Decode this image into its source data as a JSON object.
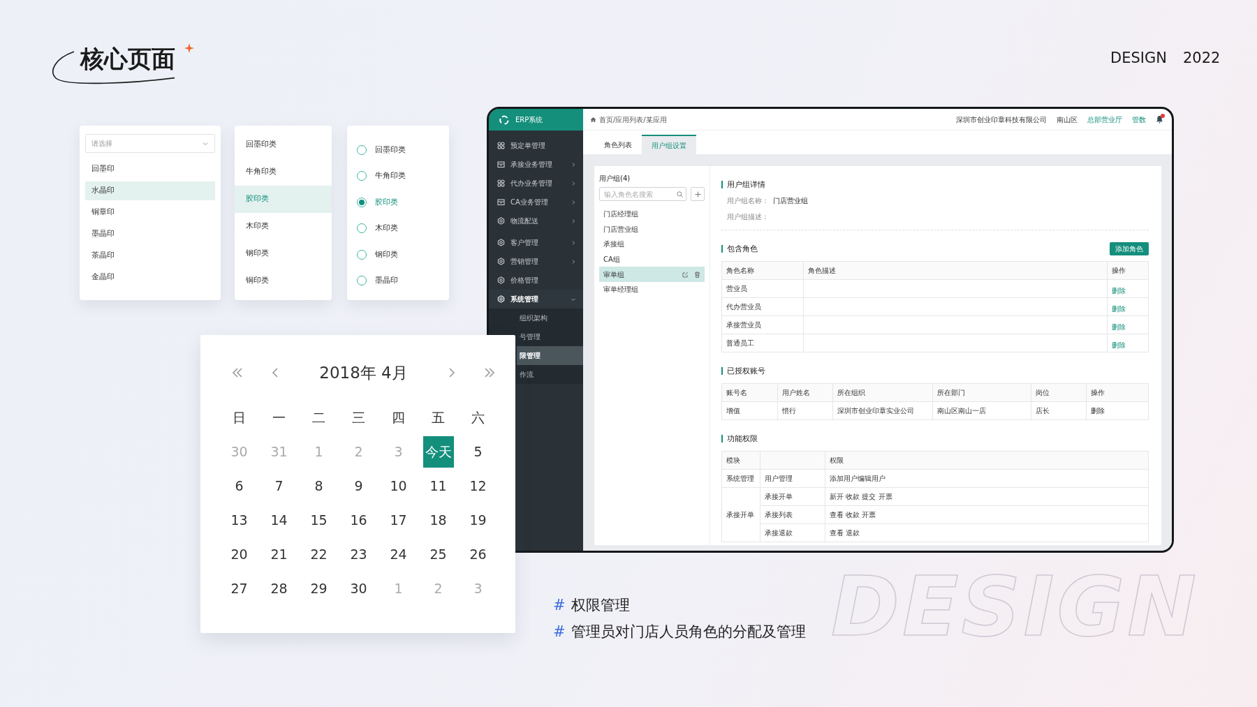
{
  "page": {
    "title": "核心页面",
    "brand": "DESIGN",
    "year": "2022",
    "background_word": "DESIGN"
  },
  "select_panel": {
    "placeholder": "请选择",
    "options": [
      {
        "label": "回墨印",
        "selected": false
      },
      {
        "label": "水晶印",
        "selected": true
      },
      {
        "label": "铜章印",
        "selected": false
      },
      {
        "label": "墨晶印",
        "selected": false
      },
      {
        "label": "茶晶印",
        "selected": false
      },
      {
        "label": "金晶印",
        "selected": false
      }
    ]
  },
  "list_panel": {
    "options": [
      {
        "label": "回墨印类",
        "selected": false
      },
      {
        "label": "牛角印类",
        "selected": false
      },
      {
        "label": "胶印类",
        "selected": true
      },
      {
        "label": "木印类",
        "selected": false
      },
      {
        "label": "钢印类",
        "selected": false
      },
      {
        "label": "铜印类",
        "selected": false
      }
    ]
  },
  "radio_panel": {
    "options": [
      {
        "label": "回墨印类",
        "selected": false
      },
      {
        "label": "牛角印类",
        "selected": false
      },
      {
        "label": "胶印类",
        "selected": true
      },
      {
        "label": "木印类",
        "selected": false
      },
      {
        "label": "钢印类",
        "selected": false
      },
      {
        "label": "墨晶印",
        "selected": false
      }
    ]
  },
  "calendar": {
    "month_label": "2018年 4月",
    "weekdays": [
      "日",
      "一",
      "二",
      "三",
      "四",
      "五",
      "六"
    ],
    "weeks": [
      [
        {
          "label": "30",
          "muted": true,
          "selected": false
        },
        {
          "label": "31",
          "muted": true,
          "selected": false
        },
        {
          "label": "1",
          "muted": true,
          "selected": false
        },
        {
          "label": "2",
          "muted": true,
          "selected": false
        },
        {
          "label": "3",
          "muted": true,
          "selected": false
        },
        {
          "label": "今天",
          "muted": false,
          "selected": true
        },
        {
          "label": "5",
          "muted": false,
          "selected": false
        }
      ],
      [
        {
          "label": "6",
          "muted": false,
          "selected": false
        },
        {
          "label": "7",
          "muted": false,
          "selected": false
        },
        {
          "label": "8",
          "muted": false,
          "selected": false
        },
        {
          "label": "9",
          "muted": false,
          "selected": false
        },
        {
          "label": "10",
          "muted": false,
          "selected": false
        },
        {
          "label": "11",
          "muted": false,
          "selected": false
        },
        {
          "label": "12",
          "muted": false,
          "selected": false
        }
      ],
      [
        {
          "label": "13",
          "muted": false,
          "selected": false
        },
        {
          "label": "14",
          "muted": false,
          "selected": false
        },
        {
          "label": "15",
          "muted": false,
          "selected": false
        },
        {
          "label": "16",
          "muted": false,
          "selected": false
        },
        {
          "label": "17",
          "muted": false,
          "selected": false
        },
        {
          "label": "18",
          "muted": false,
          "selected": false
        },
        {
          "label": "19",
          "muted": false,
          "selected": false
        }
      ],
      [
        {
          "label": "20",
          "muted": false,
          "selected": false
        },
        {
          "label": "21",
          "muted": false,
          "selected": false
        },
        {
          "label": "22",
          "muted": false,
          "selected": false
        },
        {
          "label": "23",
          "muted": false,
          "selected": false
        },
        {
          "label": "24",
          "muted": false,
          "selected": false
        },
        {
          "label": "25",
          "muted": false,
          "selected": false
        },
        {
          "label": "26",
          "muted": false,
          "selected": false
        }
      ],
      [
        {
          "label": "27",
          "muted": false,
          "selected": false
        },
        {
          "label": "28",
          "muted": false,
          "selected": false
        },
        {
          "label": "29",
          "muted": false,
          "selected": false
        },
        {
          "label": "30",
          "muted": false,
          "selected": false
        },
        {
          "label": "1",
          "muted": true,
          "selected": false
        },
        {
          "label": "2",
          "muted": true,
          "selected": false
        },
        {
          "label": "3",
          "muted": true,
          "selected": false
        }
      ]
    ]
  },
  "erp": {
    "app_name": "ERP系统",
    "breadcrumb": "首页/应用列表/某应用",
    "header_items": [
      {
        "label": "深圳市创业印章科技有限公司",
        "kind": "text"
      },
      {
        "label": "南山区",
        "kind": "text"
      },
      {
        "label": "总部营业厅",
        "kind": "link"
      },
      {
        "label": "管数",
        "kind": "link"
      }
    ],
    "sidebar": [
      {
        "label": "预定单管理",
        "kind": "grid"
      },
      {
        "label": "承接业务管理",
        "kind": "box",
        "expanded": false
      },
      {
        "label": "代办业务管理",
        "kind": "grid",
        "expanded": false
      },
      {
        "label": "CA业务管理",
        "kind": "box",
        "expanded": false
      },
      {
        "label": "物流配送",
        "kind": "gear",
        "expanded": false
      },
      {
        "label": "客户管理",
        "kind": "gear",
        "expanded": false
      },
      {
        "label": "营销管理",
        "kind": "gear",
        "expanded": false
      },
      {
        "label": "价格管理",
        "kind": "gear"
      },
      {
        "label": "系统管理",
        "kind": "gear",
        "expanded": true,
        "children": [
          {
            "label": "组织架构",
            "selected": false
          },
          {
            "label": "号管理",
            "selected": false
          },
          {
            "label": "限管理",
            "selected": true
          },
          {
            "label": "作流",
            "selected": false
          }
        ]
      }
    ],
    "tabs": [
      {
        "label": "角色列表",
        "selected": false
      },
      {
        "label": "用户组设置",
        "selected": true
      }
    ],
    "groups": {
      "title": "用户组(4)",
      "search_placeholder": "输入角色名搜索",
      "items": [
        {
          "label": "门店经理组",
          "selected": false
        },
        {
          "label": "门店营业组",
          "selected": false
        },
        {
          "label": "承接组",
          "selected": false
        },
        {
          "label": "CA组",
          "selected": false
        },
        {
          "label": "审单组",
          "selected": true
        },
        {
          "label": "审单经理组",
          "selected": false
        }
      ]
    },
    "detail": {
      "title": "用户组详情",
      "fields": [
        {
          "label": "用户组名称：",
          "value": "门店营业组"
        },
        {
          "label": "用户组描述："
        }
      ]
    },
    "roles": {
      "title": "包含角色",
      "button": "添加角色",
      "columns": [
        "角色名称",
        "角色描述",
        "操作"
      ],
      "rows": [
        {
          "name": "营业员",
          "action": "删除"
        },
        {
          "name": "代办营业员",
          "action": "删除"
        },
        {
          "name": "承接营业员",
          "action": "删除"
        },
        {
          "name": "普通员工",
          "action": "删除"
        }
      ]
    },
    "accounts": {
      "title": "已授权账号",
      "columns": [
        "账号名",
        "用户姓名",
        "所在组织",
        "所在部门",
        "岗位",
        "操作"
      ],
      "rows": [
        [
          "增值",
          "惜行",
          "深圳市创业印章实业公司",
          "南山区南山一店",
          "店长",
          "删除"
        ]
      ]
    },
    "permissions": {
      "title": "功能权限",
      "columns": [
        "模块",
        "权限"
      ],
      "groups": [
        {
          "module": "系统管理",
          "items": [
            {
              "function": "用户管理",
              "rights": "添加用户编辑用户"
            }
          ]
        },
        {
          "module": "承接开单",
          "items": [
            {
              "function": "承接开单",
              "rights": "新开 收款 提交 开票"
            },
            {
              "function": "承接列表",
              "rights": "查看 收款 开票"
            },
            {
              "function": "承接退款",
              "rights": "查看 退款"
            }
          ]
        }
      ]
    }
  },
  "captions": [
    {
      "mark": "#",
      "text": "权限管理"
    },
    {
      "mark": "#",
      "text": "管理员对门店人员角色的分配及管理"
    }
  ]
}
